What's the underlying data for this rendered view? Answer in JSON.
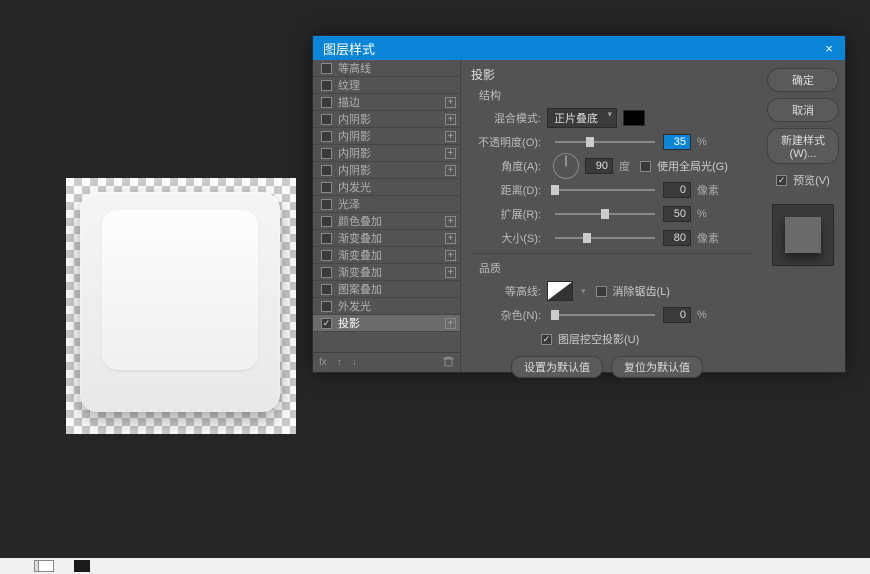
{
  "dialog": {
    "title": "图层样式",
    "close_label": "×"
  },
  "styles": {
    "items": [
      {
        "label": "等高线",
        "checked": false,
        "plus": false
      },
      {
        "label": "纹理",
        "checked": false,
        "plus": false
      },
      {
        "label": "描边",
        "checked": false,
        "plus": true
      },
      {
        "label": "内阴影",
        "checked": false,
        "plus": true
      },
      {
        "label": "内阴影",
        "checked": false,
        "plus": true
      },
      {
        "label": "内阴影",
        "checked": false,
        "plus": true
      },
      {
        "label": "内阴影",
        "checked": false,
        "plus": true
      },
      {
        "label": "内发光",
        "checked": false,
        "plus": false
      },
      {
        "label": "光泽",
        "checked": false,
        "plus": false
      },
      {
        "label": "颜色叠加",
        "checked": false,
        "plus": true
      },
      {
        "label": "渐变叠加",
        "checked": false,
        "plus": true
      },
      {
        "label": "渐变叠加",
        "checked": false,
        "plus": true
      },
      {
        "label": "渐变叠加",
        "checked": false,
        "plus": true
      },
      {
        "label": "图案叠加",
        "checked": false,
        "plus": false
      },
      {
        "label": "外发光",
        "checked": false,
        "plus": false
      },
      {
        "label": "投影",
        "checked": true,
        "plus": true,
        "selected": true
      }
    ],
    "fx_label": "fx"
  },
  "shadow": {
    "section": "投影",
    "structure": "结构",
    "blend_mode_label": "混合模式:",
    "blend_mode_value": "正片叠底",
    "opacity_label": "不透明度(O):",
    "opacity_value": "35",
    "opacity_unit": "%",
    "angle_label": "角度(A):",
    "angle_value": "90",
    "angle_unit": "度",
    "global_light_label": "使用全局光(G)",
    "distance_label": "距离(D):",
    "distance_value": "0",
    "distance_unit": "像素",
    "spread_label": "扩展(R):",
    "spread_value": "50",
    "spread_unit": "%",
    "size_label": "大小(S):",
    "size_value": "80",
    "size_unit": "像素",
    "quality": "品质",
    "contour_label": "等高线:",
    "antialias_label": "消除锯齿(L)",
    "noise_label": "杂色(N):",
    "noise_value": "0",
    "noise_unit": "%",
    "knockout_label": "图层挖空投影(U)",
    "default_btn": "设置为默认值",
    "reset_btn": "复位为默认值"
  },
  "side": {
    "ok": "确定",
    "cancel": "取消",
    "new_style": "新建样式(W)...",
    "preview": "预览(V)"
  }
}
